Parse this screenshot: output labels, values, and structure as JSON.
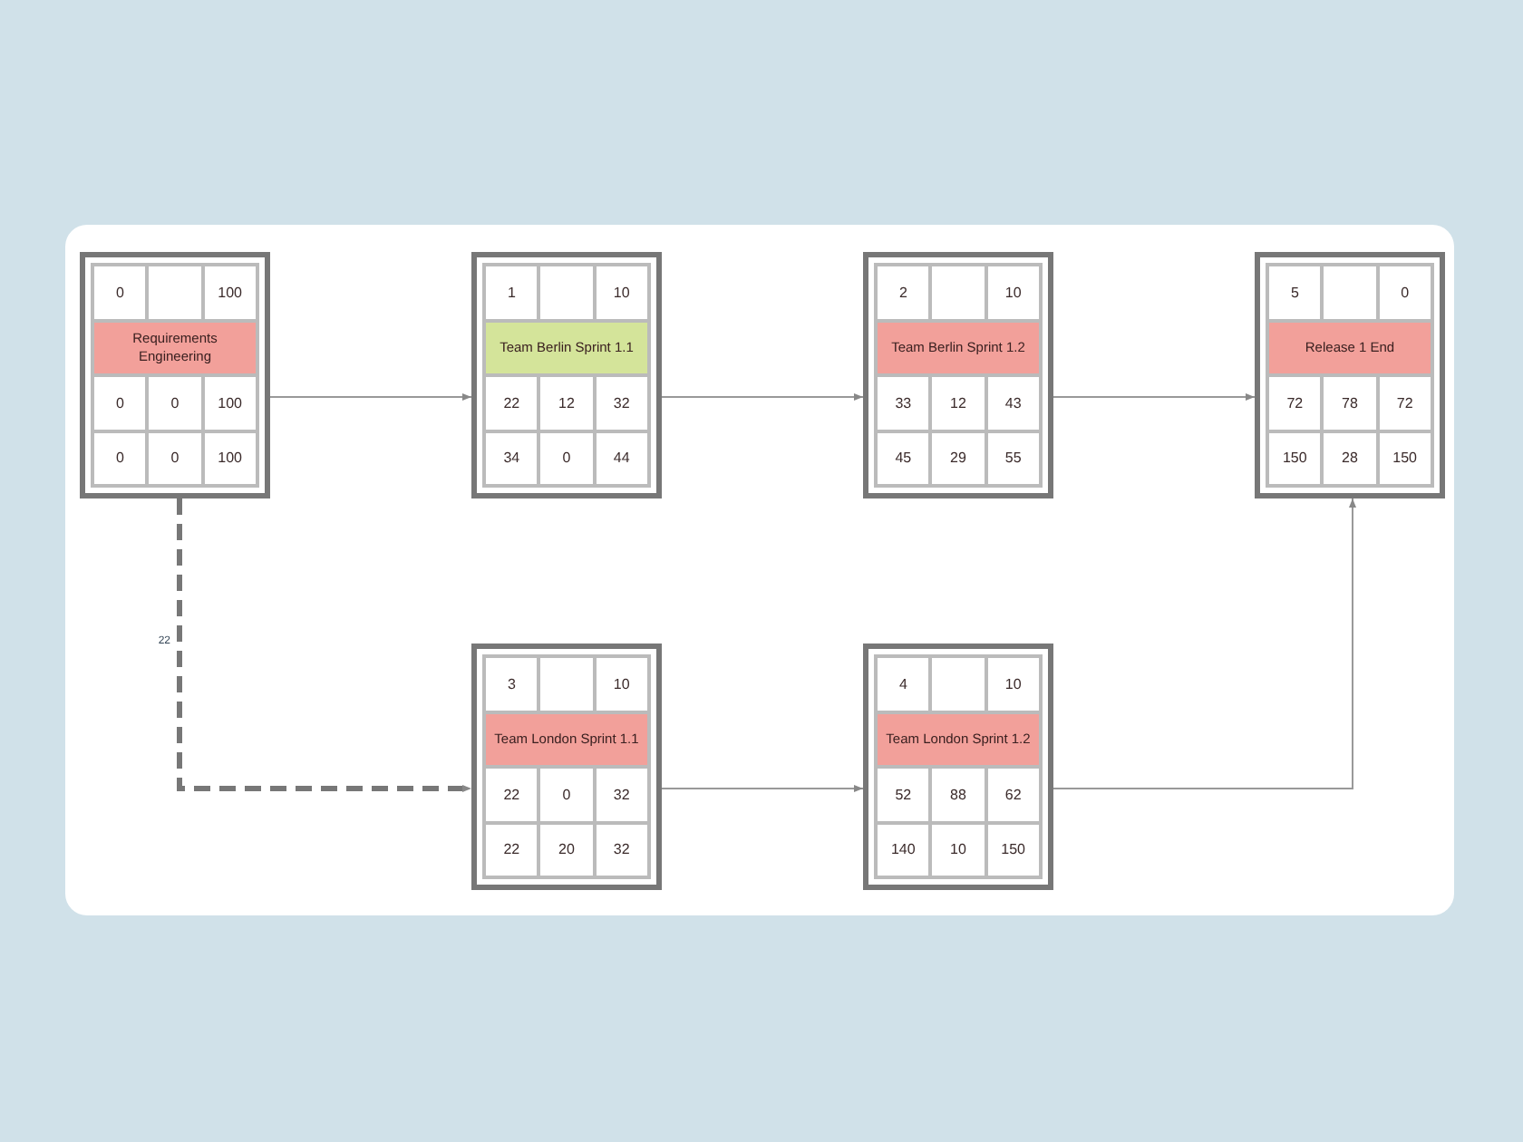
{
  "nodes": [
    {
      "number": "0",
      "duration": "100",
      "name": "Requirements Engineering",
      "color": "#f2a09a",
      "rows": [
        [
          "0",
          "0",
          "100"
        ],
        [
          "0",
          "0",
          "100"
        ]
      ]
    },
    {
      "number": "1",
      "duration": "10",
      "name": "Team Berlin Sprint 1.1",
      "color": "#d4e49a",
      "rows": [
        [
          "22",
          "12",
          "32"
        ],
        [
          "34",
          "0",
          "44"
        ]
      ]
    },
    {
      "number": "2",
      "duration": "10",
      "name": "Team Berlin Sprint 1.2",
      "color": "#f2a09a",
      "rows": [
        [
          "33",
          "12",
          "43"
        ],
        [
          "45",
          "29",
          "55"
        ]
      ]
    },
    {
      "number": "5",
      "duration": "0",
      "name": "Release 1 End",
      "color": "#f2a09a",
      "rows": [
        [
          "72",
          "78",
          "72"
        ],
        [
          "150",
          "28",
          "150"
        ]
      ]
    },
    {
      "number": "3",
      "duration": "10",
      "name": "Team London Sprint 1.1",
      "color": "#f2a09a",
      "rows": [
        [
          "22",
          "0",
          "32"
        ],
        [
          "22",
          "20",
          "32"
        ]
      ]
    },
    {
      "number": "4",
      "duration": "10",
      "name": "Team London Sprint 1.2",
      "color": "#f2a09a",
      "rows": [
        [
          "52",
          "88",
          "62"
        ],
        [
          "140",
          "10",
          "150"
        ]
      ]
    }
  ],
  "edges": [
    {
      "kind": "solid"
    },
    {
      "kind": "solid"
    },
    {
      "kind": "solid"
    },
    {
      "kind": "dashed",
      "label": "22"
    },
    {
      "kind": "solid"
    },
    {
      "kind": "solid"
    }
  ]
}
